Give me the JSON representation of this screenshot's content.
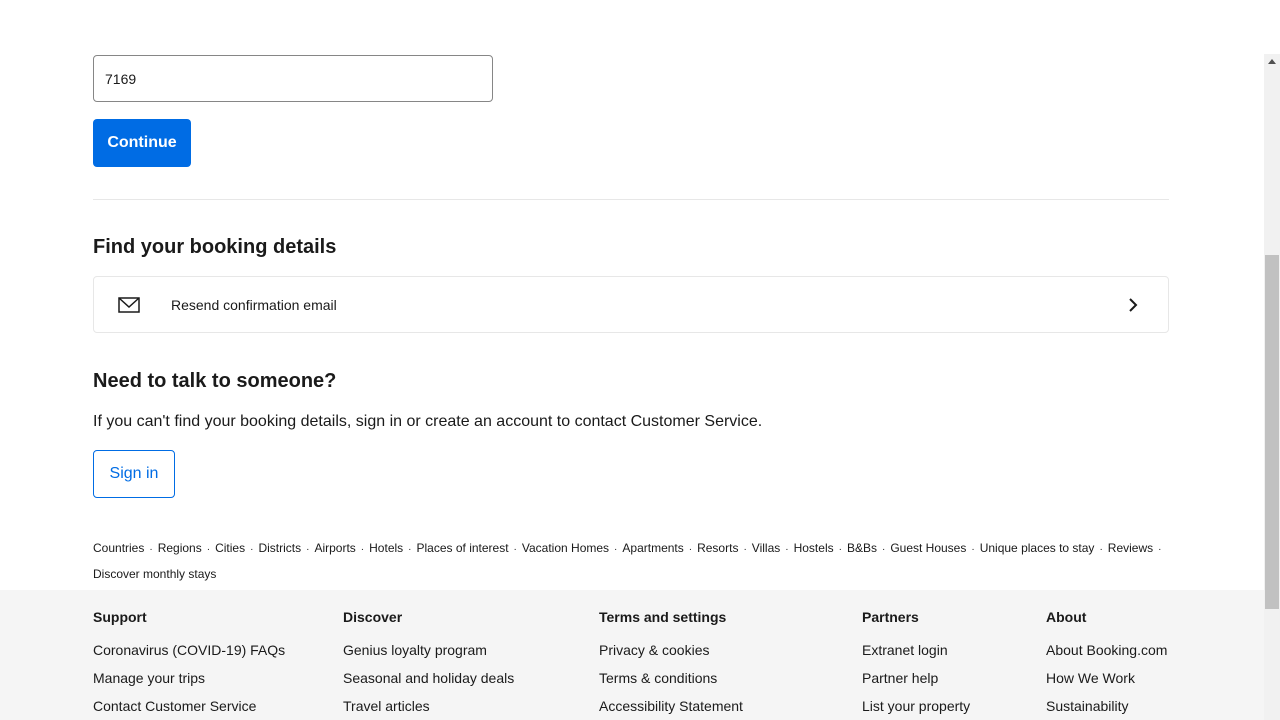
{
  "form": {
    "pin_value": "7169",
    "continue_label": "Continue"
  },
  "find_booking": {
    "title": "Find your booking details",
    "resend_label": "Resend confirmation email"
  },
  "talk": {
    "title": "Need to talk to someone?",
    "text": "If you can't find your booking details, sign in or create an account to contact Customer Service.",
    "signin_label": "Sign in"
  },
  "links": [
    "Countries",
    "Regions",
    "Cities",
    "Districts",
    "Airports",
    "Hotels",
    "Places of interest",
    "Vacation Homes",
    "Apartments",
    "Resorts",
    "Villas",
    "Hostels",
    "B&Bs",
    "Guest Houses",
    "Unique places to stay",
    "Reviews",
    "Discover monthly stays"
  ],
  "footer": {
    "support": {
      "heading": "Support",
      "links": [
        "Coronavirus (COVID-19) FAQs",
        "Manage your trips",
        "Contact Customer Service"
      ]
    },
    "discover": {
      "heading": "Discover",
      "links": [
        "Genius loyalty program",
        "Seasonal and holiday deals",
        "Travel articles"
      ]
    },
    "terms": {
      "heading": "Terms and settings",
      "links": [
        "Privacy & cookies",
        "Terms & conditions",
        "Accessibility Statement"
      ]
    },
    "partners": {
      "heading": "Partners",
      "links": [
        "Extranet login",
        "Partner help",
        "List your property"
      ]
    },
    "about": {
      "heading": "About",
      "links": [
        "About Booking.com",
        "How We Work",
        "Sustainability"
      ]
    }
  },
  "icons": {
    "resend": "envelope-icon",
    "resend_arrow": "chevron-right-icon",
    "scroll_up": "arrow-up-icon"
  },
  "colors": {
    "primary": "#006ce4",
    "footer_bg": "#f5f5f5",
    "text": "#1a1a1a"
  }
}
